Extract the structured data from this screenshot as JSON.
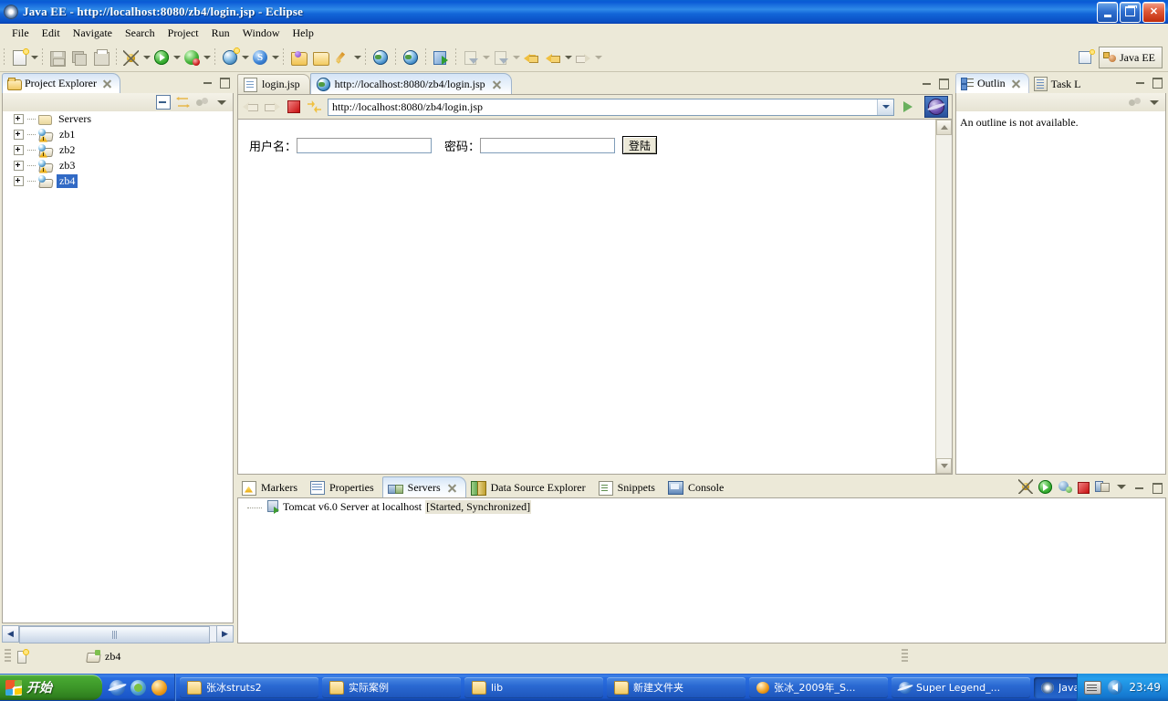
{
  "window": {
    "title": "Java EE - http://localhost:8080/zb4/login.jsp - Eclipse",
    "icon": "eclipse-icon",
    "minimize_label": "Minimize",
    "maximize_label": "Restore",
    "close_label": "Close"
  },
  "menubar": {
    "items": [
      {
        "label": "File"
      },
      {
        "label": "Edit"
      },
      {
        "label": "Navigate"
      },
      {
        "label": "Search"
      },
      {
        "label": "Project"
      },
      {
        "label": "Run"
      },
      {
        "label": "Window"
      },
      {
        "label": "Help"
      }
    ]
  },
  "toolbar": {
    "icons": [
      "new-document-icon",
      "save-icon",
      "save-all-icon",
      "print-icon",
      "debug-icon",
      "run-icon",
      "profile-icon",
      "new-web-project-icon",
      "new-server-icon",
      "open-package-icon",
      "open-folder-icon",
      "edit-pencil-icon",
      "globe-icon",
      "run-external-web-icon",
      "next-annotation-icon",
      "previous-annotation-icon",
      "back-icon",
      "forward-icon"
    ]
  },
  "perspective": {
    "open_label": "Open Perspective",
    "active": "Java EE",
    "icon": "java-ee-perspective-icon"
  },
  "project_explorer": {
    "tab_label": "Project Explorer",
    "view_toolbar": [
      "collapse-all-icon",
      "link-with-editor-icon",
      "view-filter-icon",
      "view-menu-icon"
    ],
    "tree": [
      {
        "label": "Servers",
        "icon": "folder-icon",
        "expandable": true,
        "warning": false,
        "selected": false
      },
      {
        "label": "zb1",
        "icon": "dynamic-web-project-icon",
        "expandable": true,
        "warning": true,
        "selected": false
      },
      {
        "label": "zb2",
        "icon": "dynamic-web-project-icon",
        "expandable": true,
        "warning": true,
        "selected": false
      },
      {
        "label": "zb3",
        "icon": "dynamic-web-project-icon",
        "expandable": true,
        "warning": true,
        "selected": false
      },
      {
        "label": "zb4",
        "icon": "dynamic-web-project-icon",
        "expandable": true,
        "warning": false,
        "selected": true
      }
    ]
  },
  "editor": {
    "tabs": [
      {
        "label": "login.jsp",
        "icon": "jsp-file-icon",
        "active": false,
        "closable": false
      },
      {
        "label": "http://localhost:8080/zb4/login.jsp",
        "icon": "web-browser-icon",
        "active": true,
        "closable": true
      }
    ],
    "browser": {
      "back_icon": "back-arrow-icon",
      "forward_icon": "forward-arrow-icon",
      "stop_icon": "stop-icon",
      "refresh_icon": "refresh-icon",
      "url": "http://localhost:8080/zb4/login.jsp",
      "url_placeholder": "",
      "dropdown_icon": "chevron-down-icon",
      "go_icon": "go-icon",
      "external_browser_icon": "open-in-external-browser-icon"
    },
    "page": {
      "username_label": "用户名：",
      "username_value": "",
      "password_label": "密码：",
      "password_value": "",
      "submit_label": "登陆"
    }
  },
  "outline": {
    "tabs": [
      {
        "label": "Outlin",
        "icon": "outline-icon",
        "active": true,
        "closable": true
      },
      {
        "label": "Task L",
        "icon": "task-list-icon",
        "active": false,
        "closable": false
      }
    ],
    "view_toolbar": [
      "view-filter-icon",
      "view-menu-icon"
    ],
    "message": "An outline is not available."
  },
  "bottom_panel": {
    "tabs": [
      {
        "label": "Markers",
        "icon": "markers-icon",
        "active": false,
        "closable": false
      },
      {
        "label": "Properties",
        "icon": "properties-icon",
        "active": false,
        "closable": false
      },
      {
        "label": "Servers",
        "icon": "servers-icon",
        "active": true,
        "closable": true
      },
      {
        "label": "Data Source Explorer",
        "icon": "data-source-explorer-icon",
        "active": false,
        "closable": false
      },
      {
        "label": "Snippets",
        "icon": "snippets-icon",
        "active": false,
        "closable": false
      },
      {
        "label": "Console",
        "icon": "console-icon",
        "active": false,
        "closable": false
      }
    ],
    "view_toolbar": [
      "debug-server-icon",
      "start-server-icon",
      "profile-server-icon",
      "stop-server-icon",
      "publish-icon",
      "view-menu-icon"
    ],
    "servers": [
      {
        "name": "Tomcat v6.0 Server at localhost",
        "state": "[Started, Synchronized]",
        "icon": "tomcat-server-icon"
      }
    ]
  },
  "statusbar": {
    "new_icon": "new-item-icon",
    "project_icon": "project-icon",
    "project_label": "zb4"
  },
  "taskbar": {
    "start_label": "开始",
    "quick_launch": [
      "internet-explorer-icon",
      "media-player-icon",
      "firefox-icon"
    ],
    "tasks": [
      {
        "label": "张冰struts2",
        "icon": "folder-icon",
        "active": false
      },
      {
        "label": "实际案例",
        "icon": "folder-icon",
        "active": false
      },
      {
        "label": "lib",
        "icon": "folder-icon",
        "active": false
      },
      {
        "label": "新建文件夹",
        "icon": "folder-icon",
        "active": false
      },
      {
        "label": "张冰_2009年_S...",
        "icon": "media-icon",
        "active": false
      },
      {
        "label": "Super Legend_...",
        "icon": "internet-explorer-icon",
        "active": false
      },
      {
        "label": "Java EE - htt...",
        "icon": "eclipse-icon",
        "active": true
      }
    ],
    "tray": [
      "ime-icon",
      "volume-icon"
    ],
    "clock": "23:49"
  },
  "colors": {
    "titlebar_blue": "#0a5ad6",
    "selection_blue": "#316ac5",
    "chrome_beige": "#ece9d8",
    "taskbar_blue": "#2a69d2",
    "start_green": "#3c9628"
  }
}
